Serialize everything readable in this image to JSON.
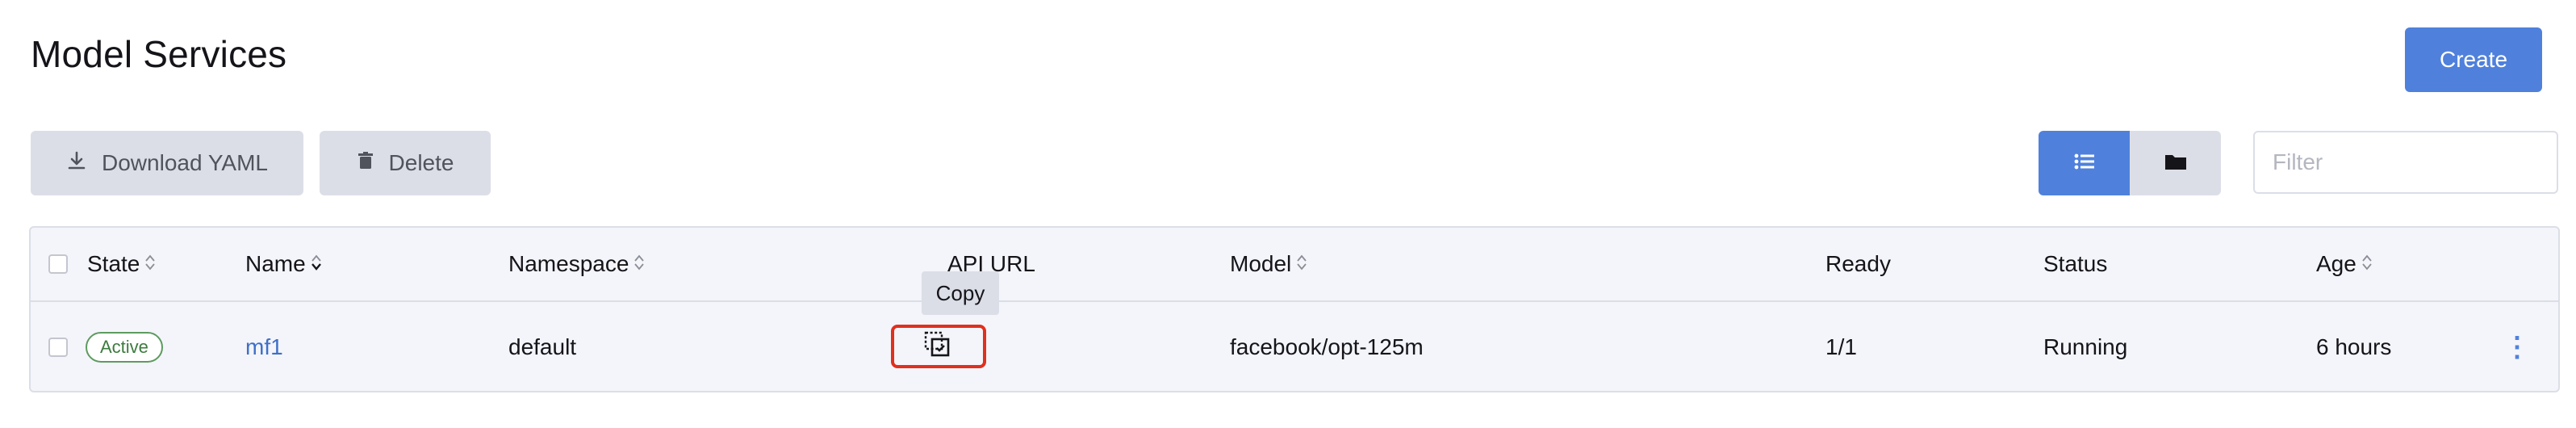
{
  "page": {
    "title": "Model Services"
  },
  "actions": {
    "create_label": "Create"
  },
  "toolbar": {
    "download_yaml_label": "Download YAML",
    "delete_label": "Delete",
    "view_modes": [
      "list-view-icon",
      "folder-view-icon"
    ],
    "active_view": "list"
  },
  "filter": {
    "placeholder": "Filter",
    "value": ""
  },
  "table": {
    "columns": {
      "state": "State",
      "name": "Name",
      "namespace": "Namespace",
      "api_url": "API URL",
      "model": "Model",
      "ready": "Ready",
      "status": "Status",
      "age": "Age"
    },
    "rows": [
      {
        "state": "Active",
        "name": "mf1",
        "namespace": "default",
        "model": "facebook/opt-125m",
        "ready": "1/1",
        "status": "Running",
        "age": "6 hours"
      }
    ]
  },
  "tooltip": {
    "text": "Copy"
  },
  "colors": {
    "accent": "#4f81dc",
    "highlight": "#e0301e",
    "badge_green": "#5d9b5f"
  }
}
